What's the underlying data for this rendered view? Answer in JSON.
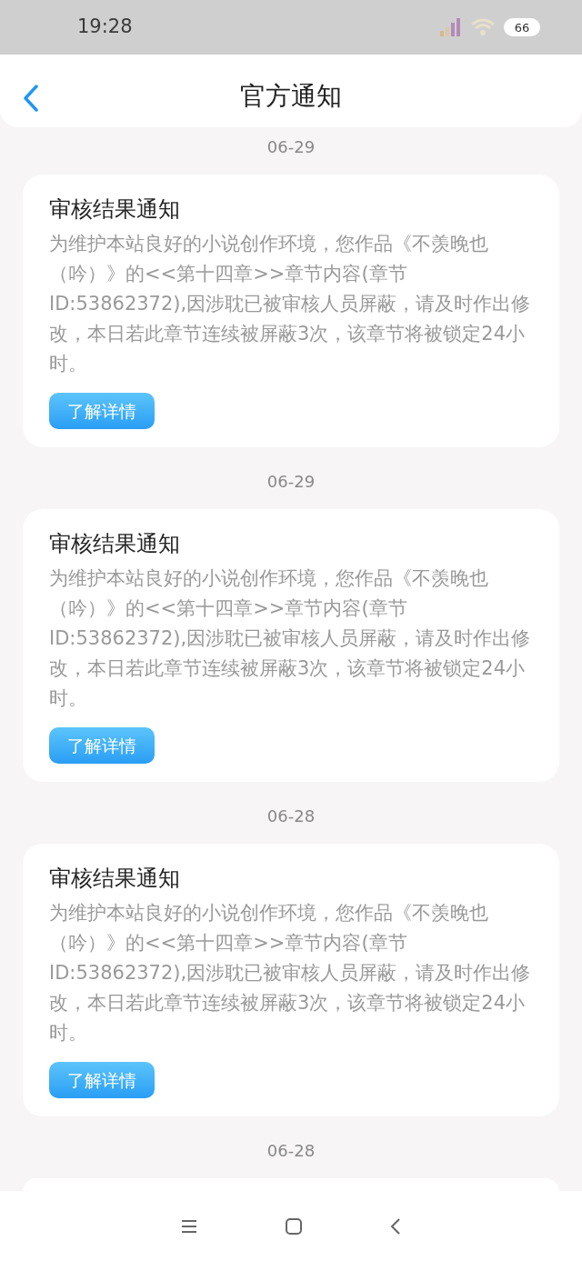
{
  "status_bar": {
    "time": "19:28",
    "battery": "66"
  },
  "header": {
    "title": "官方通知"
  },
  "notices": [
    {
      "date": "06-29",
      "title": "审核结果通知",
      "body": "为维护本站良好的小说创作环境，您作品《不羡晚也（吟）》的<<第十四章>>章节内容(章节ID:53862372),因涉耽已被审核人员屏蔽，请及时作出修改，本日若此章节连续被屏蔽3次，该章节将被锁定24小时。",
      "button": "了解详情"
    },
    {
      "date": "06-29",
      "title": "审核结果通知",
      "body": "为维护本站良好的小说创作环境，您作品《不羡晚也（吟）》的<<第十四章>>章节内容(章节ID:53862372),因涉耽已被审核人员屏蔽，请及时作出修改，本日若此章节连续被屏蔽3次，该章节将被锁定24小时。",
      "button": "了解详情"
    },
    {
      "date": "06-28",
      "title": "审核结果通知",
      "body": "为维护本站良好的小说创作环境，您作品《不羡晚也（吟）》的<<第十四章>>章节内容(章节ID:53862372),因涉耽已被审核人员屏蔽，请及时作出修改，本日若此章节连续被屏蔽3次，该章节将被锁定24小时。",
      "button": "了解详情"
    },
    {
      "date": "06-28"
    }
  ]
}
